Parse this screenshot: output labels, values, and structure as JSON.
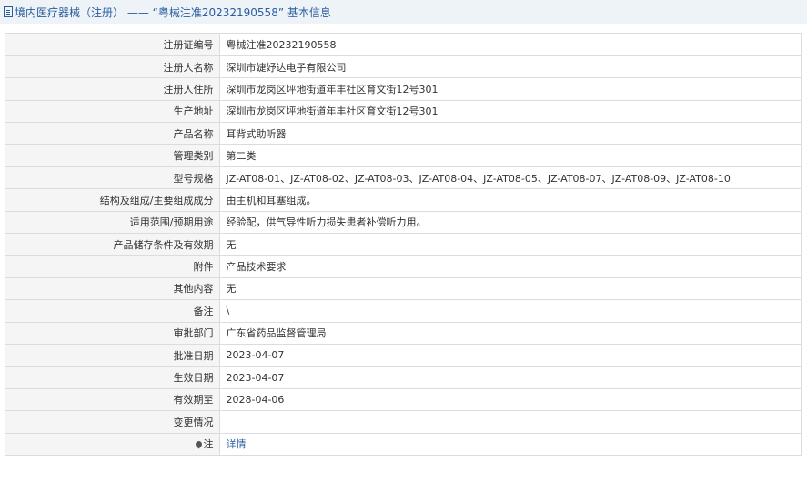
{
  "header": {
    "title": "境内医疗器械（注册） —— “粤械注准20232190558” 基本信息"
  },
  "rows": [
    {
      "label": "注册证编号",
      "value": "粤械注准20232190558"
    },
    {
      "label": "注册人名称",
      "value": "深圳市婕妤达电子有限公司"
    },
    {
      "label": "注册人住所",
      "value": "深圳市龙岗区坪地街道年丰社区育文街12号301"
    },
    {
      "label": "生产地址",
      "value": "深圳市龙岗区坪地街道年丰社区育文街12号301"
    },
    {
      "label": "产品名称",
      "value": "耳背式助听器"
    },
    {
      "label": "管理类别",
      "value": "第二类"
    },
    {
      "label": "型号规格",
      "value": "JZ-AT08-01、JZ-AT08-02、JZ-AT08-03、JZ-AT08-04、JZ-AT08-05、JZ-AT08-07、JZ-AT08-09、JZ-AT08-10"
    },
    {
      "label": "结构及组成/主要组成成分",
      "value": "由主机和耳塞组成。"
    },
    {
      "label": "适用范围/预期用途",
      "value": "经验配，供气导性听力损失患者补偿听力用。"
    },
    {
      "label": "产品储存条件及有效期",
      "value": "无"
    },
    {
      "label": "附件",
      "value": "产品技术要求"
    },
    {
      "label": "其他内容",
      "value": "无"
    },
    {
      "label": "备注",
      "value": "\\"
    },
    {
      "label": "审批部门",
      "value": "广东省药品监督管理局"
    },
    {
      "label": "批准日期",
      "value": "2023-04-07"
    },
    {
      "label": "生效日期",
      "value": "2023-04-07"
    },
    {
      "label": "有效期至",
      "value": "2028-04-06"
    },
    {
      "label": "变更情况",
      "value": ""
    }
  ],
  "note": {
    "label": "注",
    "link": "详情",
    "icon": "map-pin-icon"
  }
}
